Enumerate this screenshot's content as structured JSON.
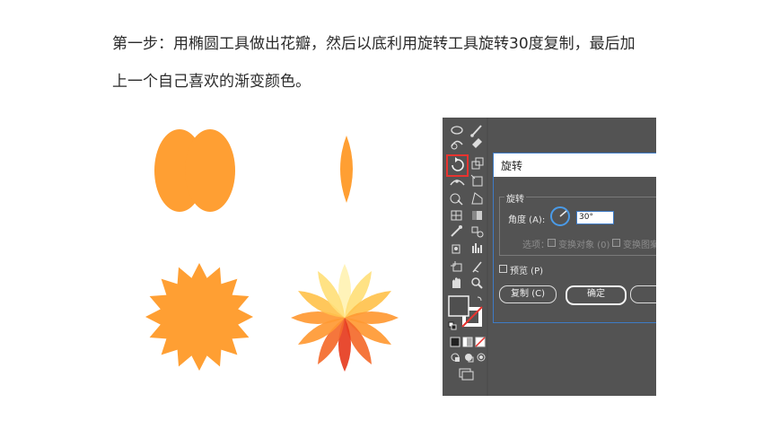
{
  "instruction": {
    "line1": "第一步：用椭圆工具做出花瓣，然后以底利用旋转工具旋转30度复制，最后加",
    "line2": "上一个自己喜欢的渐变颜色。"
  },
  "rotate_dialog": {
    "title": "旋转",
    "group_label": "旋转",
    "angle_label": "角度 (A):",
    "angle_value": "30°",
    "options_label": "选项：",
    "transform_objects": "变换对象 (0)",
    "transform_patterns": "变换图案",
    "preview_label": "预览 (P)",
    "copy_button": "复制 (C)",
    "ok_button": "确定"
  },
  "colors": {
    "petal_orange": "#FF9F33",
    "highlight_red": "#E8332F",
    "dialog_border": "#3E7BC6",
    "panel_dark": "#535353",
    "gradient": [
      "#FFF2B3",
      "#FFE07A",
      "#FFC24D",
      "#FF9933",
      "#F46A2B",
      "#E63C1F"
    ]
  },
  "icons": [
    "ellipse-tool-icon",
    "paintbrush-tool-icon",
    "shaper-tool-icon",
    "eraser-tool-icon",
    "rotate-tool-icon",
    "scale-tool-icon",
    "width-tool-icon",
    "free-transform-tool-icon",
    "shape-builder-tool-icon",
    "perspective-grid-tool-icon",
    "mesh-tool-icon",
    "gradient-tool-icon",
    "eyedropper-tool-icon",
    "blend-tool-icon",
    "symbol-sprayer-tool-icon",
    "column-graph-tool-icon",
    "artboard-tool-icon",
    "slice-tool-icon",
    "hand-tool-icon",
    "zoom-tool-icon",
    "fill-swatch-icon",
    "stroke-swatch-icon",
    "swap-colors-icon",
    "default-colors-icon",
    "color-mode-icon",
    "gradient-mode-icon",
    "none-mode-icon",
    "draw-normal-icon",
    "draw-behind-icon",
    "draw-inside-icon",
    "screen-mode-icon"
  ]
}
